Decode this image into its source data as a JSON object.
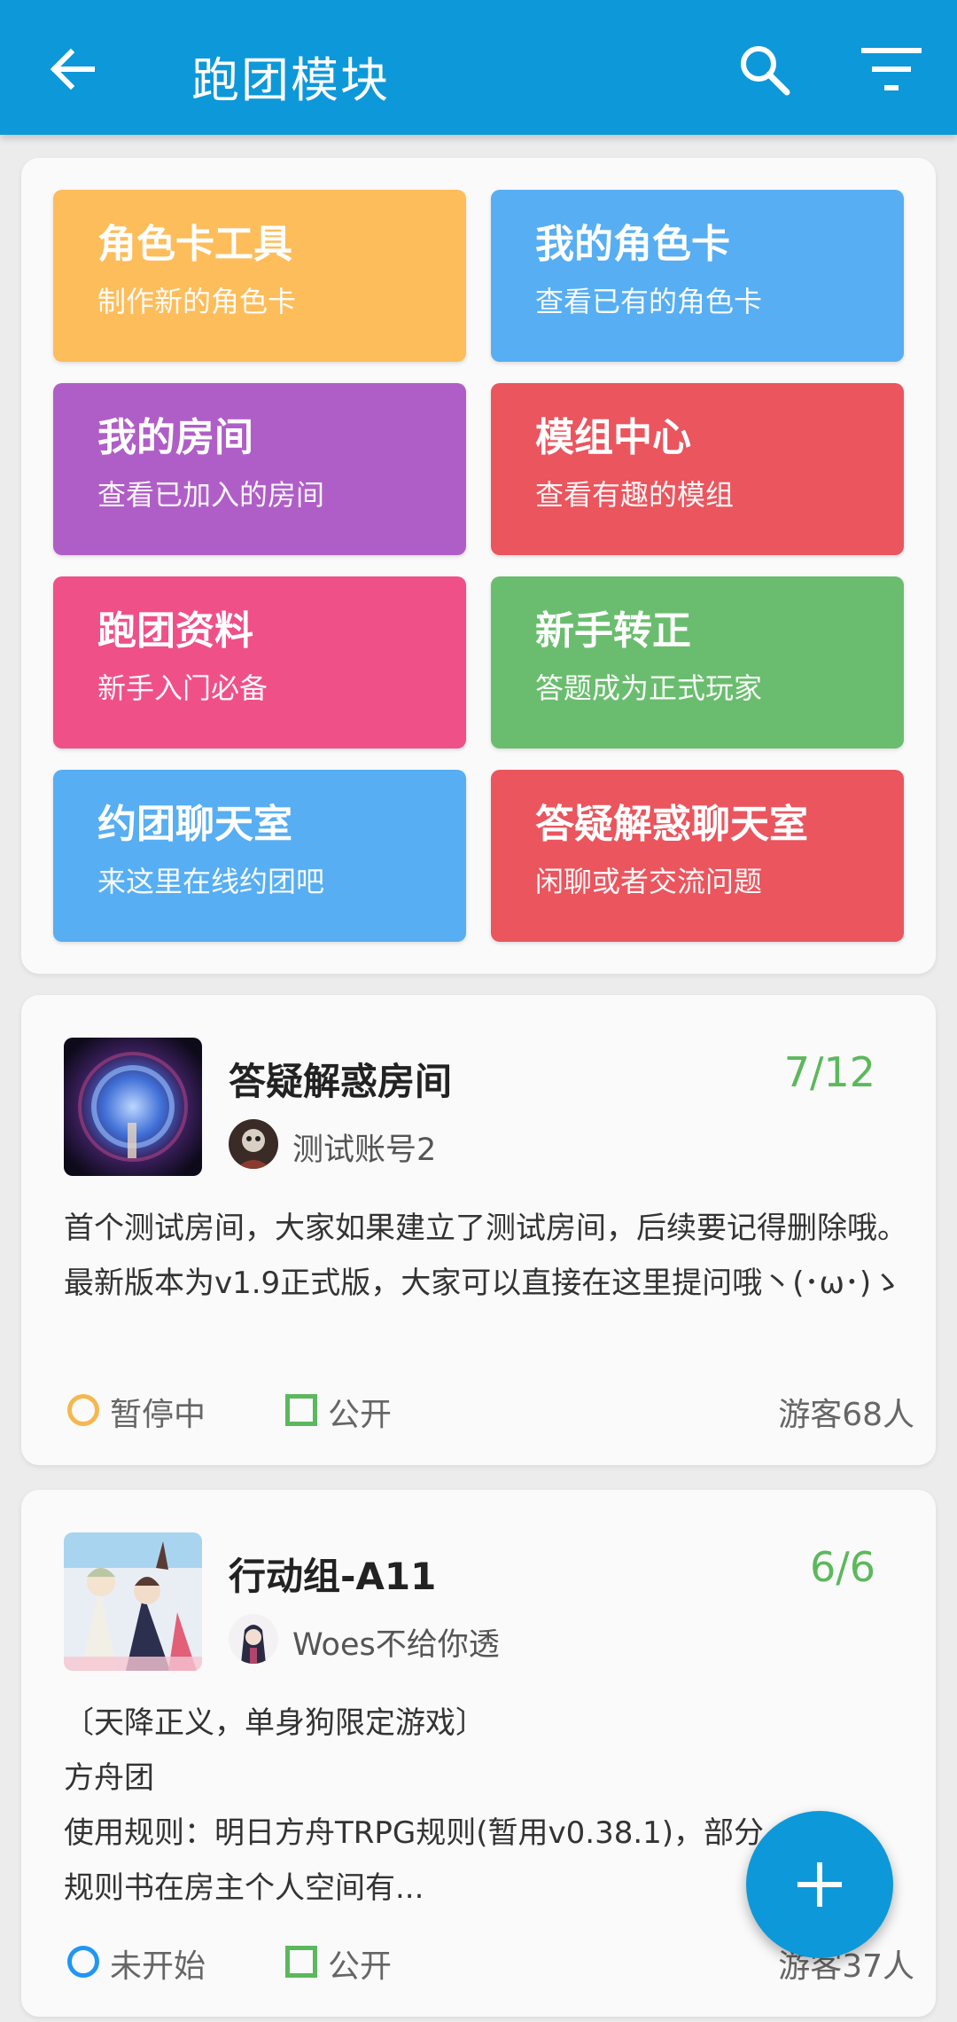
{
  "appbar": {
    "title": "跑团模块",
    "back_icon": "arrow-back-icon",
    "search_icon": "search-icon",
    "filter_icon": "filter-icon",
    "color": "#0d98d9"
  },
  "tools": [
    {
      "title": "角色卡工具",
      "subtitle": "制作新的角色卡",
      "color": "#fdbd5b"
    },
    {
      "title": "我的角色卡",
      "subtitle": "查看已有的角色卡",
      "color": "#57aef2"
    },
    {
      "title": "我的房间",
      "subtitle": "查看已加入的房间",
      "color": "#b05ec7"
    },
    {
      "title": "模组中心",
      "subtitle": "查看有趣的模组",
      "color": "#ea555e"
    },
    {
      "title": "跑团资料",
      "subtitle": "新手入门必备",
      "color": "#ef5088"
    },
    {
      "title": "新手转正",
      "subtitle": "答题成为正式玩家",
      "color": "#6abd6e"
    },
    {
      "title": "约团聊天室",
      "subtitle": "来这里在线约团吧",
      "color": "#57aef2"
    },
    {
      "title": "答疑解惑聊天室",
      "subtitle": "闲聊或者交流问题",
      "color": "#ea555e"
    }
  ],
  "rooms": [
    {
      "name": "答疑解惑房间",
      "count": "7/12",
      "owner": "测试账号2",
      "description": "首个测试房间，大家如果建立了测试房间，后续要记得删除哦。最新版本为v1.9正式版，大家可以直接在这里提问哦丶(･ω･)ゝ",
      "status": "暂停中",
      "status_color": "#f5b74e",
      "visibility": "公开",
      "visitors": "游客68人"
    },
    {
      "name": "行动组-A11",
      "count": "6/6",
      "owner": "Woes不给你透",
      "description": "〔天降正义，单身狗限定游戏〕\n方舟团\n使用规则：明日方舟TRPG规则(暂用v0.38.1)，部分\n规则书在房主个人空间有...",
      "status": "未开始",
      "status_color": "#2196f3",
      "visibility": "公开",
      "visitors": "游客37人"
    }
  ],
  "fab": {
    "icon": "add-icon"
  }
}
